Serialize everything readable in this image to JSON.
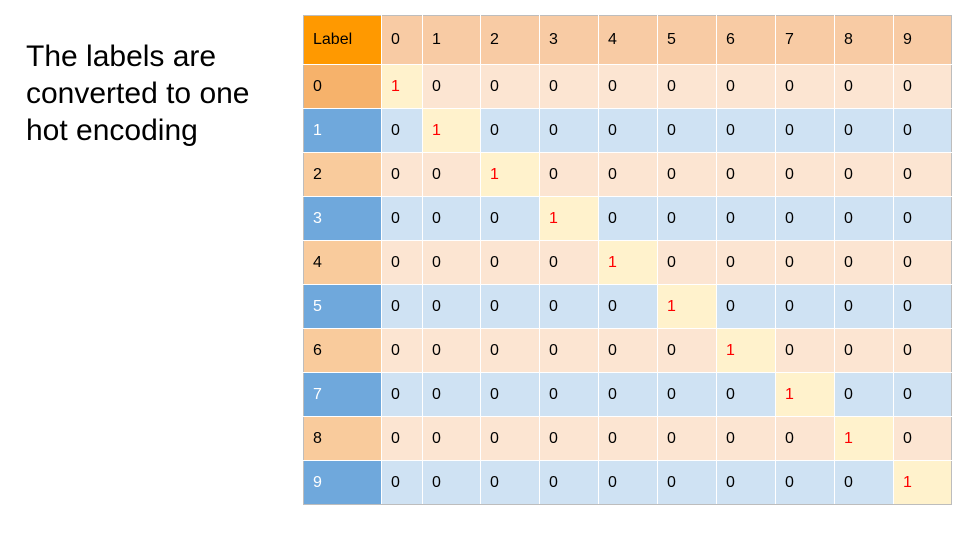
{
  "caption": "The labels are converted to one hot encoding",
  "table": {
    "corner_label": "Label",
    "columns": [
      "0",
      "1",
      "2",
      "3",
      "4",
      "5",
      "6",
      "7",
      "8",
      "9"
    ],
    "rows": [
      {
        "label": "0",
        "values": [
          "1",
          "0",
          "0",
          "0",
          "0",
          "0",
          "0",
          "0",
          "0",
          "0"
        ]
      },
      {
        "label": "1",
        "values": [
          "0",
          "1",
          "0",
          "0",
          "0",
          "0",
          "0",
          "0",
          "0",
          "0"
        ]
      },
      {
        "label": "2",
        "values": [
          "0",
          "0",
          "1",
          "0",
          "0",
          "0",
          "0",
          "0",
          "0",
          "0"
        ]
      },
      {
        "label": "3",
        "values": [
          "0",
          "0",
          "0",
          "1",
          "0",
          "0",
          "0",
          "0",
          "0",
          "0"
        ]
      },
      {
        "label": "4",
        "values": [
          "0",
          "0",
          "0",
          "0",
          "1",
          "0",
          "0",
          "0",
          "0",
          "0"
        ]
      },
      {
        "label": "5",
        "values": [
          "0",
          "0",
          "0",
          "0",
          "0",
          "1",
          "0",
          "0",
          "0",
          "0"
        ]
      },
      {
        "label": "6",
        "values": [
          "0",
          "0",
          "0",
          "0",
          "0",
          "0",
          "1",
          "0",
          "0",
          "0"
        ]
      },
      {
        "label": "7",
        "values": [
          "0",
          "0",
          "0",
          "0",
          "0",
          "0",
          "0",
          "1",
          "0",
          "0"
        ]
      },
      {
        "label": "8",
        "values": [
          "0",
          "0",
          "0",
          "0",
          "0",
          "0",
          "0",
          "0",
          "1",
          "0"
        ]
      },
      {
        "label": "9",
        "values": [
          "0",
          "0",
          "0",
          "0",
          "0",
          "0",
          "0",
          "0",
          "0",
          "1"
        ]
      }
    ]
  },
  "colors": {
    "header_corner": "#ff9900",
    "header": "#f8cba4",
    "peach_row": "#fce5d2",
    "blue_row": "#cfe2f3",
    "blue_label": "#6fa8dc",
    "hot_cell": "#fff2cc",
    "hot_text": "#ff0000"
  }
}
